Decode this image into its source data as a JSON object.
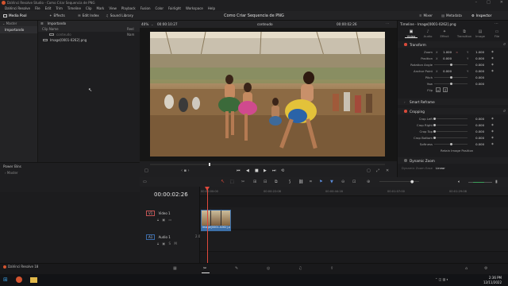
{
  "window": {
    "title": "DaVinci Resolve Studio - Como Criar Sequencia de PNG",
    "controls": [
      "–",
      "□",
      "✕"
    ]
  },
  "menu": [
    "DaVinci Resolve",
    "File",
    "Edit",
    "Trim",
    "Timeline",
    "Clip",
    "Mark",
    "View",
    "Playback",
    "Fusion",
    "Color",
    "Fairlight",
    "Workspace",
    "Help"
  ],
  "toolbar": {
    "media_pool": "Media Pool",
    "effects": "Effects",
    "edit_index": "Edit Index",
    "sound_library": "Sound Library",
    "project_title": "Como Criar Sequencia de PNG",
    "mixer": "Mixer",
    "metadata": "Metadata",
    "inspector": "Inspector"
  },
  "media_pool": {
    "header": "Importando",
    "master": "Master",
    "bins": [
      "Importando"
    ],
    "column_clip": "Clip Name",
    "column_reel": "Reel Nam",
    "clips": [
      {
        "name": "conteudo",
        "dim": true
      },
      {
        "name": "Image[0001-0262].png",
        "dim": false
      }
    ],
    "power_bins": "Power Bins",
    "power_master": "Master"
  },
  "viewer": {
    "zoom": "40%",
    "source_tc": "00:00:10:27",
    "clip_name": "conteudo",
    "current_tc": "00:00:02:26"
  },
  "inspector": {
    "timeline_title": "Timeline - Image[0001-0262].png",
    "tabs": [
      "Video",
      "Audio",
      "Effect",
      "Transition",
      "Image",
      "File"
    ],
    "transform": "Transform",
    "zoom_label": "Zoom",
    "zoom_x": "1.000",
    "zoom_y": "1.000",
    "position_label": "Position",
    "pos_x": "0.000",
    "pos_y": "0.000",
    "rotation_label": "Rotation Angle",
    "rotation": "0.000",
    "anchor_label": "Anchor Point",
    "anchor_x": "0.000",
    "anchor_y": "0.000",
    "pitch_label": "Pitch",
    "pitch": "0.000",
    "yaw_label": "Yaw",
    "yaw": "0.000",
    "flip_label": "Flip",
    "smart_reframe": "Smart Reframe",
    "cropping": "Cropping",
    "crop_left_label": "Crop Left",
    "crop_left": "0.000",
    "crop_right_label": "Crop Right",
    "crop_right": "0.000",
    "crop_top_label": "Crop Top",
    "crop_top": "0.000",
    "crop_bottom_label": "Crop Bottom",
    "crop_bottom": "0.000",
    "softness_label": "Softness",
    "softness": "0.000",
    "retain_label": "Retain Image Position",
    "dynamic_zoom": "Dynamic Zoom",
    "ease_label": "Dynamic Zoom Ease",
    "ease_value": "Linear"
  },
  "timeline": {
    "timecode": "00:00:02:26",
    "ruler": [
      "00:00:00:00",
      "00:00:22:08",
      "00:00:44:16",
      "00:01:07:00",
      "00:01:29:08",
      "00:01:51:16"
    ],
    "video_track": {
      "badge": "V1",
      "name": "Video 1"
    },
    "audio_track": {
      "badge": "A1",
      "name": "Audio 1",
      "level": "2.0"
    },
    "clip_label": "Image[0001-0262].png"
  },
  "pages": [
    "media",
    "cut",
    "edit",
    "fusion",
    "color",
    "fairlight",
    "deliver"
  ],
  "status": {
    "app": "DaVinci Resolve 18"
  },
  "taskbar": {
    "time": "2:36 PM",
    "date": "12/11/2022"
  },
  "colors": {
    "accent_red": "#d94a3a",
    "playhead": "#e0493c",
    "clip_blue": "#3c6fa8"
  }
}
